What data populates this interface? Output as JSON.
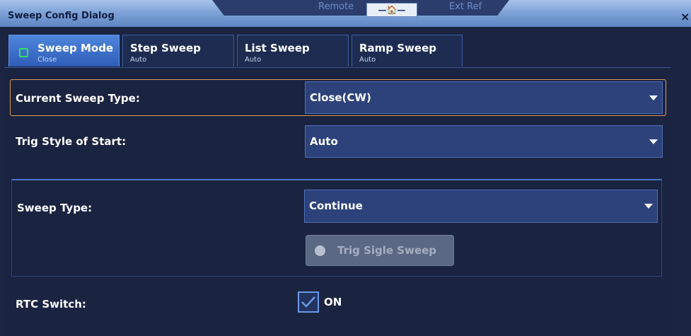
{
  "window": {
    "title": "Sweep Config Dialog",
    "close_glyph": "×",
    "status_left": "Remote",
    "status_right": "Ext Ref",
    "home_glyph": "—🏠—",
    "home_icon": "home-icon"
  },
  "tabs": [
    {
      "label": "Sweep Mode",
      "sub": "Close",
      "active": true
    },
    {
      "label": "Step Sweep",
      "sub": "Auto",
      "active": false
    },
    {
      "label": "List Sweep",
      "sub": "Auto",
      "active": false
    },
    {
      "label": "Ramp Sweep",
      "sub": "Auto",
      "active": false
    }
  ],
  "fields": {
    "current_sweep_type": {
      "label": "Current Sweep Type:",
      "value": "Close(CW)"
    },
    "trig_style": {
      "label": "Trig Style of Start:",
      "value": "Auto"
    },
    "sweep_type": {
      "label": "Sweep Type:",
      "value": "Continue"
    },
    "trig_button": {
      "label": "Trig Sigle Sweep",
      "enabled": false
    },
    "rtc_switch": {
      "label": "RTC Switch:",
      "state_label": "ON",
      "checked": true
    }
  },
  "colors": {
    "accent": "#2e5db8",
    "focus_border": "#d99a5b",
    "checkbox_check": "#6a9ae8"
  }
}
